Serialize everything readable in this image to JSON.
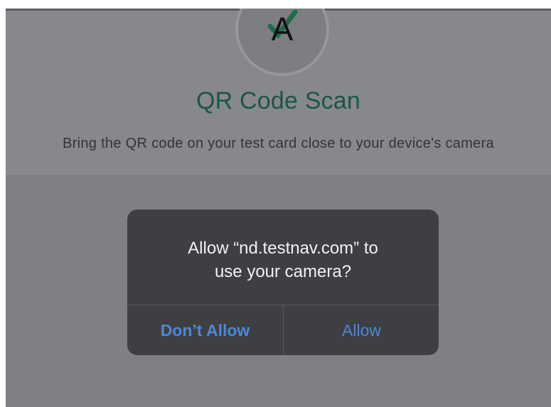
{
  "page": {
    "title": "QR Code Scan",
    "subtitle": "Bring the QR code on your test card close to your device's camera",
    "logo": {
      "icon": "testnav-logo-icon",
      "letter": "A",
      "check_color": "#1f6b4e",
      "letter_color": "#111111"
    }
  },
  "dialog": {
    "message_line1": "Allow “nd.testnav.com” to",
    "message_line2": "use your camera?",
    "deny_label": "Don’t Allow",
    "allow_label": "Allow"
  },
  "colors": {
    "overlay": "#7f8083",
    "title": "#1b5548",
    "dialog_bg": "#3e3f42",
    "dialog_button": "#4a88d7"
  }
}
